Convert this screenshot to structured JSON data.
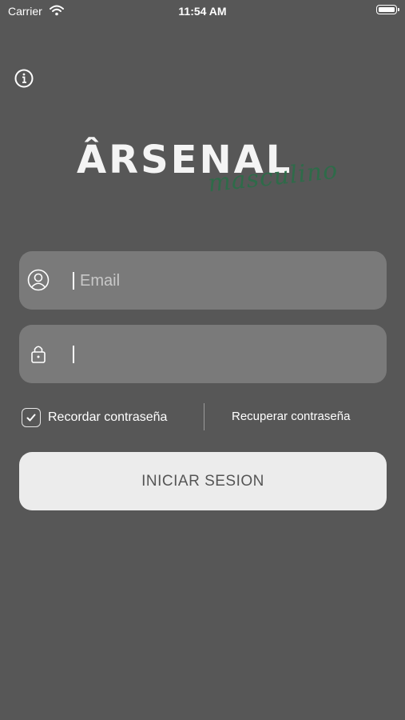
{
  "status_bar": {
    "carrier": "Carrier",
    "time": "11:54 AM"
  },
  "logo": {
    "main": "ÂRSENAL",
    "script": "masculino"
  },
  "login_form": {
    "email_placeholder": "Email",
    "password_value": "",
    "remember_label": "Recordar contraseña",
    "remember_checked": true,
    "recover_label": "Recuperar contraseña",
    "submit_label": "INICIAR SESION"
  },
  "colors": {
    "background": "#575757",
    "field": "#7a7a7a",
    "button": "#ececec",
    "brand_green": "#2e6b49"
  },
  "icons": [
    "wifi-icon",
    "battery-icon",
    "info-icon",
    "user-icon",
    "lock-icon",
    "checkmark-icon"
  ]
}
